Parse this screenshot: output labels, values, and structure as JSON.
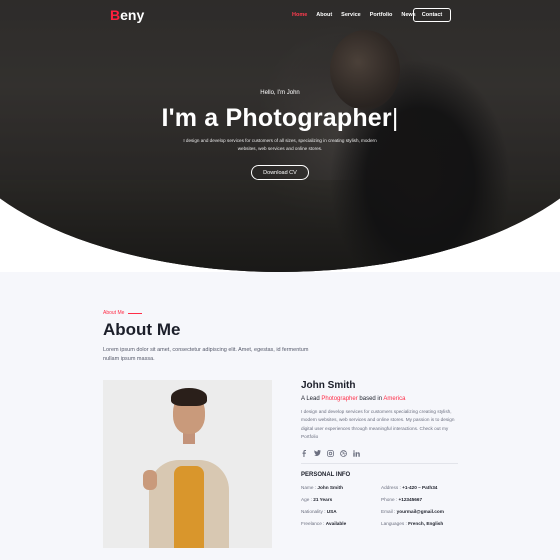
{
  "nav": {
    "logo_first": "B",
    "logo_rest": "eny",
    "links": [
      "Home",
      "About",
      "Service",
      "Portfolio",
      "News"
    ],
    "contact": "Contact"
  },
  "hero": {
    "hello": "Hello, I'm John",
    "title": "I'm a Photographer",
    "cursor": "|",
    "description": "I design and develop services for customers of all sizes, specializing in creating stylish, modern websites, web services and online stores.",
    "cv_button": "Download CV"
  },
  "about": {
    "label": "About Me",
    "title": "About Me",
    "lead": "Lorem ipsum dolor sit amet, consectetur adipiscing elit. Amet, egestas, id fermentum nullam ipsum massa.",
    "name": "John Smith",
    "role_prefix": "A Lead ",
    "role_accent": "Photographer",
    "role_mid": " based in ",
    "role_place": "America",
    "description": "I design and develop services for customers specializing creating stylish, modern websites, web services and online stores. My passion is to design digital user experiences through meaningful interactions. Check out my Portfolio",
    "socials": [
      "facebook-icon",
      "twitter-icon",
      "instagram-icon",
      "dribbble-icon",
      "linkedin-icon"
    ],
    "personal_info_title": "PERSONAL INFO",
    "info": [
      {
        "label": "Name : ",
        "value": "John Smith"
      },
      {
        "label": "Address : ",
        "value": "+1-420 – Path34"
      },
      {
        "label": "Age : ",
        "value": "21 Years"
      },
      {
        "label": "Phone : ",
        "value": "+12345667"
      },
      {
        "label": "Nationality : ",
        "value": "USA"
      },
      {
        "label": "Email : ",
        "value": "yourmail@gmail.com"
      },
      {
        "label": "Freelance : ",
        "value": "Available"
      },
      {
        "label": "Languages : ",
        "value": "French, English"
      }
    ]
  },
  "colors": {
    "accent": "#ff2d47",
    "dark": "#1c1f2a"
  }
}
